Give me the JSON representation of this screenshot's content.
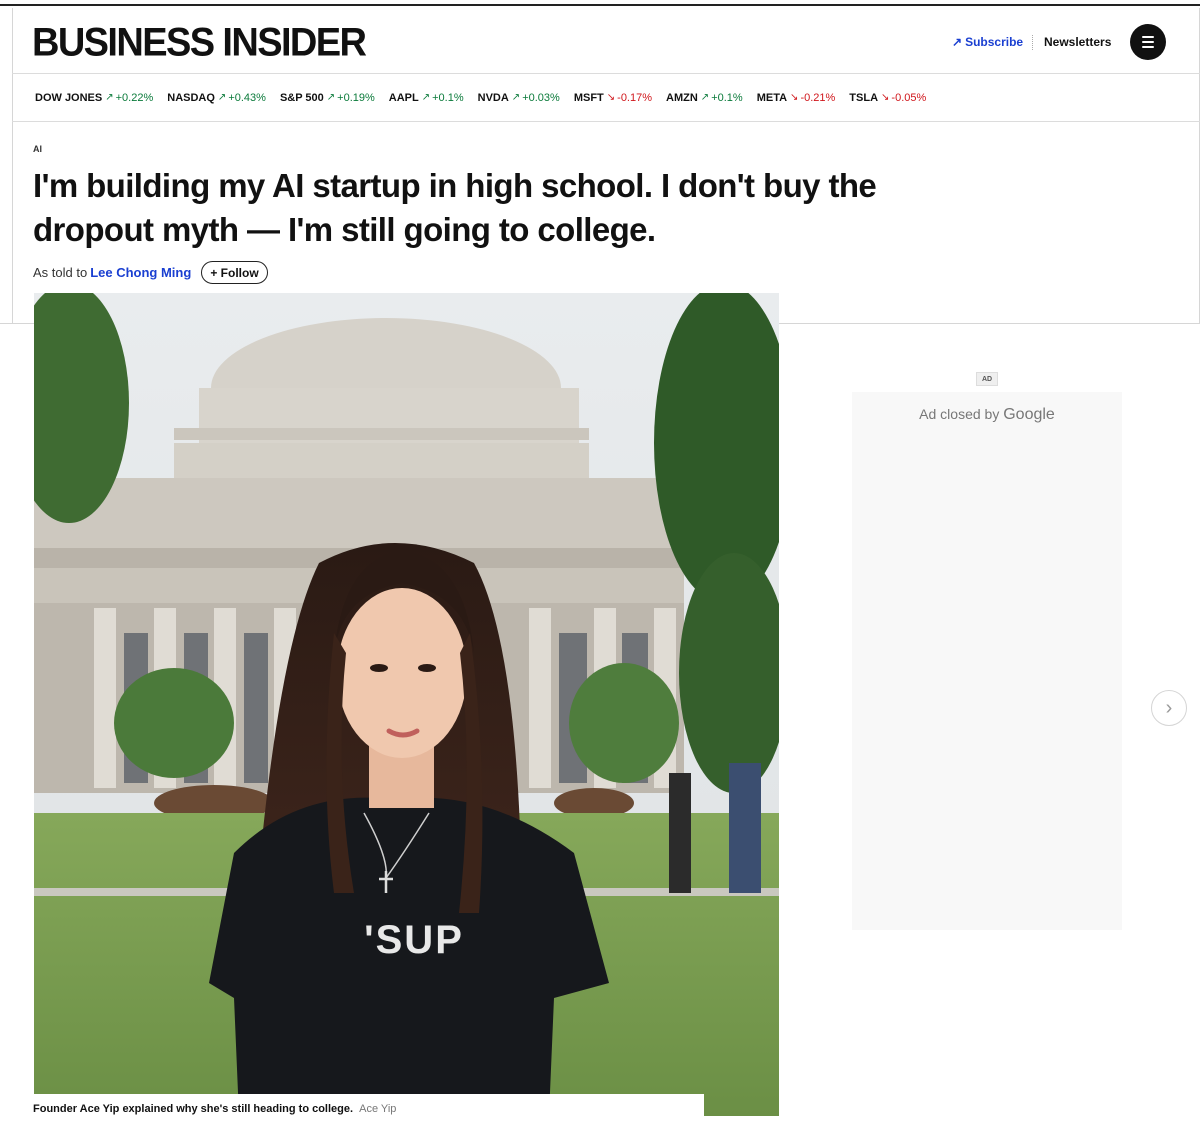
{
  "header": {
    "logo": "BUSINESS INSIDER",
    "subscribe_label": "Subscribe",
    "newsletters_label": "Newsletters",
    "menu_icon": "hamburger-menu-icon"
  },
  "ticker": [
    {
      "symbol": "DOW JONES",
      "direction": "up",
      "change": "+0.22%"
    },
    {
      "symbol": "NASDAQ",
      "direction": "up",
      "change": "+0.43%"
    },
    {
      "symbol": "S&P 500",
      "direction": "up",
      "change": "+0.19%"
    },
    {
      "symbol": "AAPL",
      "direction": "up",
      "change": "+0.1%"
    },
    {
      "symbol": "NVDA",
      "direction": "up",
      "change": "+0.03%"
    },
    {
      "symbol": "MSFT",
      "direction": "down",
      "change": "-0.17%"
    },
    {
      "symbol": "AMZN",
      "direction": "up",
      "change": "+0.1%"
    },
    {
      "symbol": "META",
      "direction": "down",
      "change": "-0.21%"
    },
    {
      "symbol": "TSLA",
      "direction": "down",
      "change": "-0.05%"
    }
  ],
  "colors": {
    "up": "#0a7a3a",
    "down": "#d0161b",
    "link": "#1a3fd1"
  },
  "article": {
    "category": "AI",
    "headline": "I'm building my AI startup in high school. I don't buy the dropout myth — I'm still going to college.",
    "byline_prefix": "As told to",
    "author": "Lee Chong Ming",
    "follow_label": "+ Follow",
    "image": {
      "shirt_text": "'SUP",
      "caption": "Founder Ace Yip explained why she's still heading to college.",
      "credit": "Ace Yip"
    }
  },
  "sidebar": {
    "ad_label": "AD",
    "ad_closed_text": "Ad closed by",
    "ad_closed_brand": "Google",
    "next_icon": "chevron-right-icon"
  }
}
